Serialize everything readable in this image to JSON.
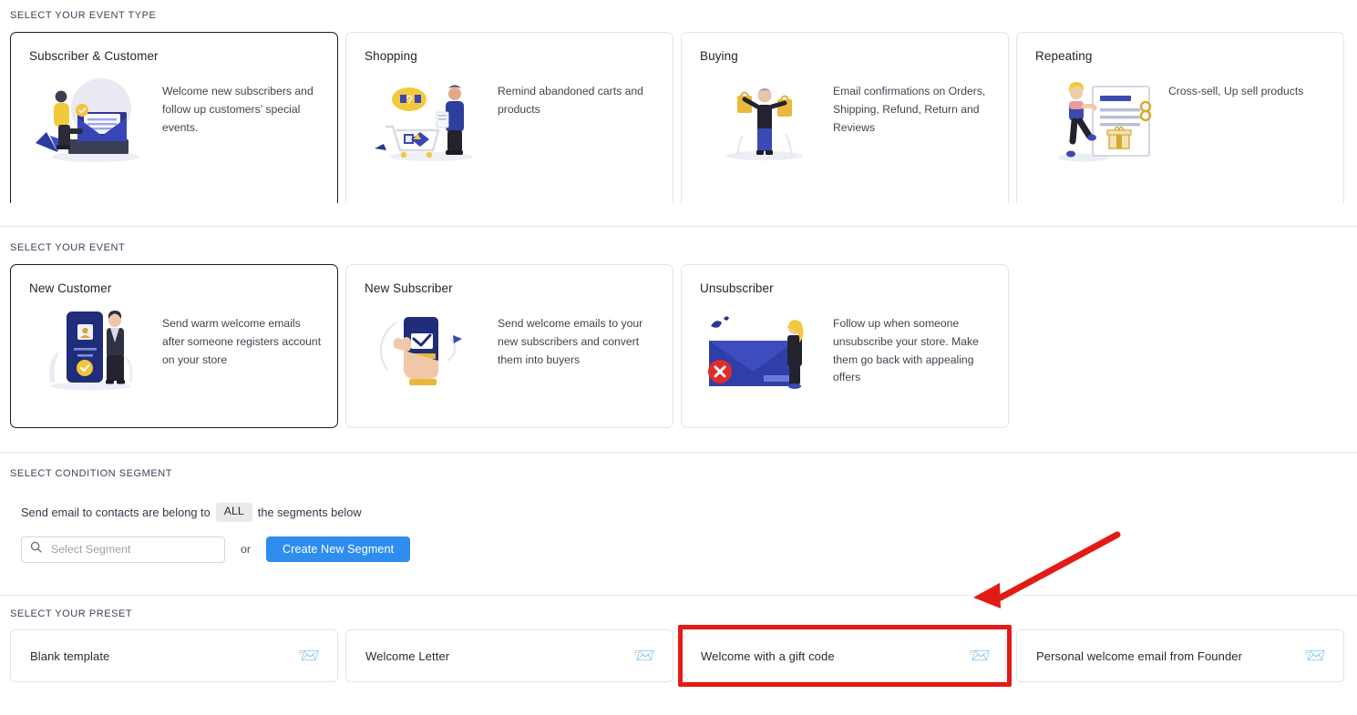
{
  "sections": {
    "event_type": {
      "label": "SELECT YOUR EVENT TYPE"
    },
    "event": {
      "label": "SELECT YOUR EVENT"
    },
    "condition": {
      "label": "SELECT CONDITION SEGMENT"
    },
    "preset": {
      "label": "SELECT YOUR PRESET"
    }
  },
  "event_types": [
    {
      "title": "Subscriber & Customer",
      "description": "Welcome new subscribers and follow up customers' special events.",
      "illustration": "person-with-envelope-illustration",
      "selected": true
    },
    {
      "title": "Shopping",
      "description": "Remind abandoned carts and products",
      "illustration": "person-with-shopping-cart-illustration",
      "selected": false
    },
    {
      "title": "Buying",
      "description": "Email confirmations on Orders, Shipping, Refund, Return and Reviews",
      "illustration": "person-holding-shopping-bags-illustration",
      "selected": false
    },
    {
      "title": "Repeating",
      "description": "Cross-sell, Up sell products",
      "illustration": "person-with-gift-document-illustration",
      "selected": false
    }
  ],
  "events": [
    {
      "title": "New Customer",
      "description": "Send warm welcome emails after someone registers account on your store",
      "illustration": "phone-profile-person-illustration",
      "selected": true
    },
    {
      "title": "New Subscriber",
      "description": "Send welcome emails to your new subscribers and convert them into buyers",
      "illustration": "hand-holding-phone-checkmark-illustration",
      "selected": false
    },
    {
      "title": "Unsubscriber",
      "description": "Follow up when someone unsubscribe your store. Make them go back with appealing offers",
      "illustration": "envelope-with-red-x-illustration",
      "selected": false
    }
  ],
  "condition": {
    "sentence_before": "Send email to contacts are belong to",
    "match_badge": "ALL",
    "sentence_after": "the segments below",
    "segment_placeholder": "Select Segment",
    "segment_value": "",
    "search_icon": "search-icon",
    "or_label": "or",
    "create_button": "Create New Segment"
  },
  "presets": [
    {
      "label": "Blank template",
      "icon": "incoming-envelope-icon",
      "highlighted": false
    },
    {
      "label": "Welcome Letter",
      "icon": "incoming-envelope-icon",
      "highlighted": false
    },
    {
      "label": "Welcome with a gift code",
      "icon": "incoming-envelope-icon",
      "highlighted": true
    },
    {
      "label": "Personal welcome email from Founder",
      "icon": "incoming-envelope-icon",
      "highlighted": false
    }
  ],
  "annotation": {
    "type": "red-arrow-callout",
    "target": "Welcome with a gift code",
    "color": "#e31b16"
  },
  "colors": {
    "accent_blue": "#2f8ded",
    "card_border": "#e3e4e8",
    "selected_border": "#1a1a1a",
    "annotation_red": "#e31b16",
    "badge_grey": "#e9eaec"
  },
  "icons": {
    "preset_glyph": "📨",
    "search_glyph": "search"
  }
}
